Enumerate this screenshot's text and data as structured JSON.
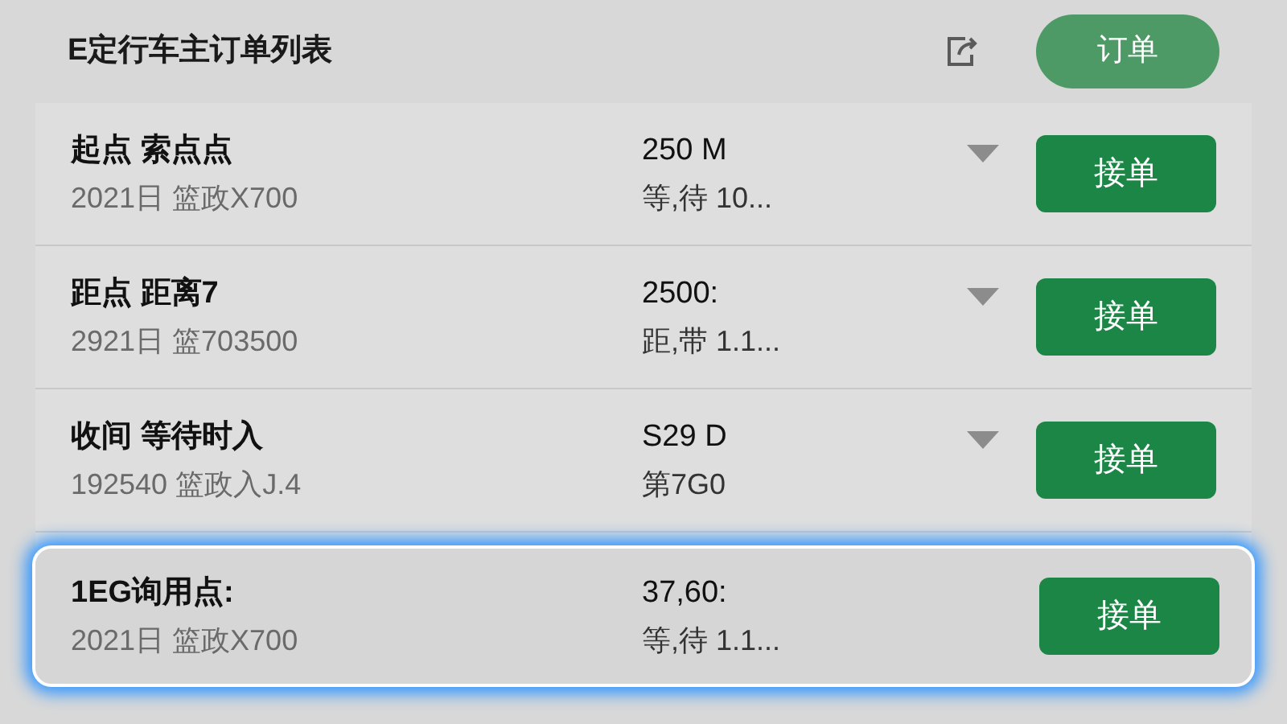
{
  "header": {
    "title": "E定行车主订单列表",
    "button": "订单"
  },
  "orders": [
    {
      "title": "起点 索点点",
      "subtitle": "2021日 篮政X700",
      "value": "250 M",
      "detail": "等,待 10...",
      "dropdown": true,
      "selected": false,
      "action": "接单"
    },
    {
      "title": "距点 距离7",
      "subtitle": "2921日 篮703500",
      "value": "2500:",
      "detail": "距,带 1.1...",
      "dropdown": true,
      "selected": false,
      "action": "接单"
    },
    {
      "title": "收间 等待时入",
      "subtitle": "192540 篮政入J.4",
      "value": "S29 D",
      "detail": "第7G0",
      "dropdown": true,
      "selected": false,
      "action": "接单"
    },
    {
      "title": "1EG询用点:",
      "subtitle": "2021日 篮政X700",
      "value": "37,60:",
      "detail": "等,待 1.1...",
      "dropdown": false,
      "selected": true,
      "action": "接单"
    }
  ]
}
